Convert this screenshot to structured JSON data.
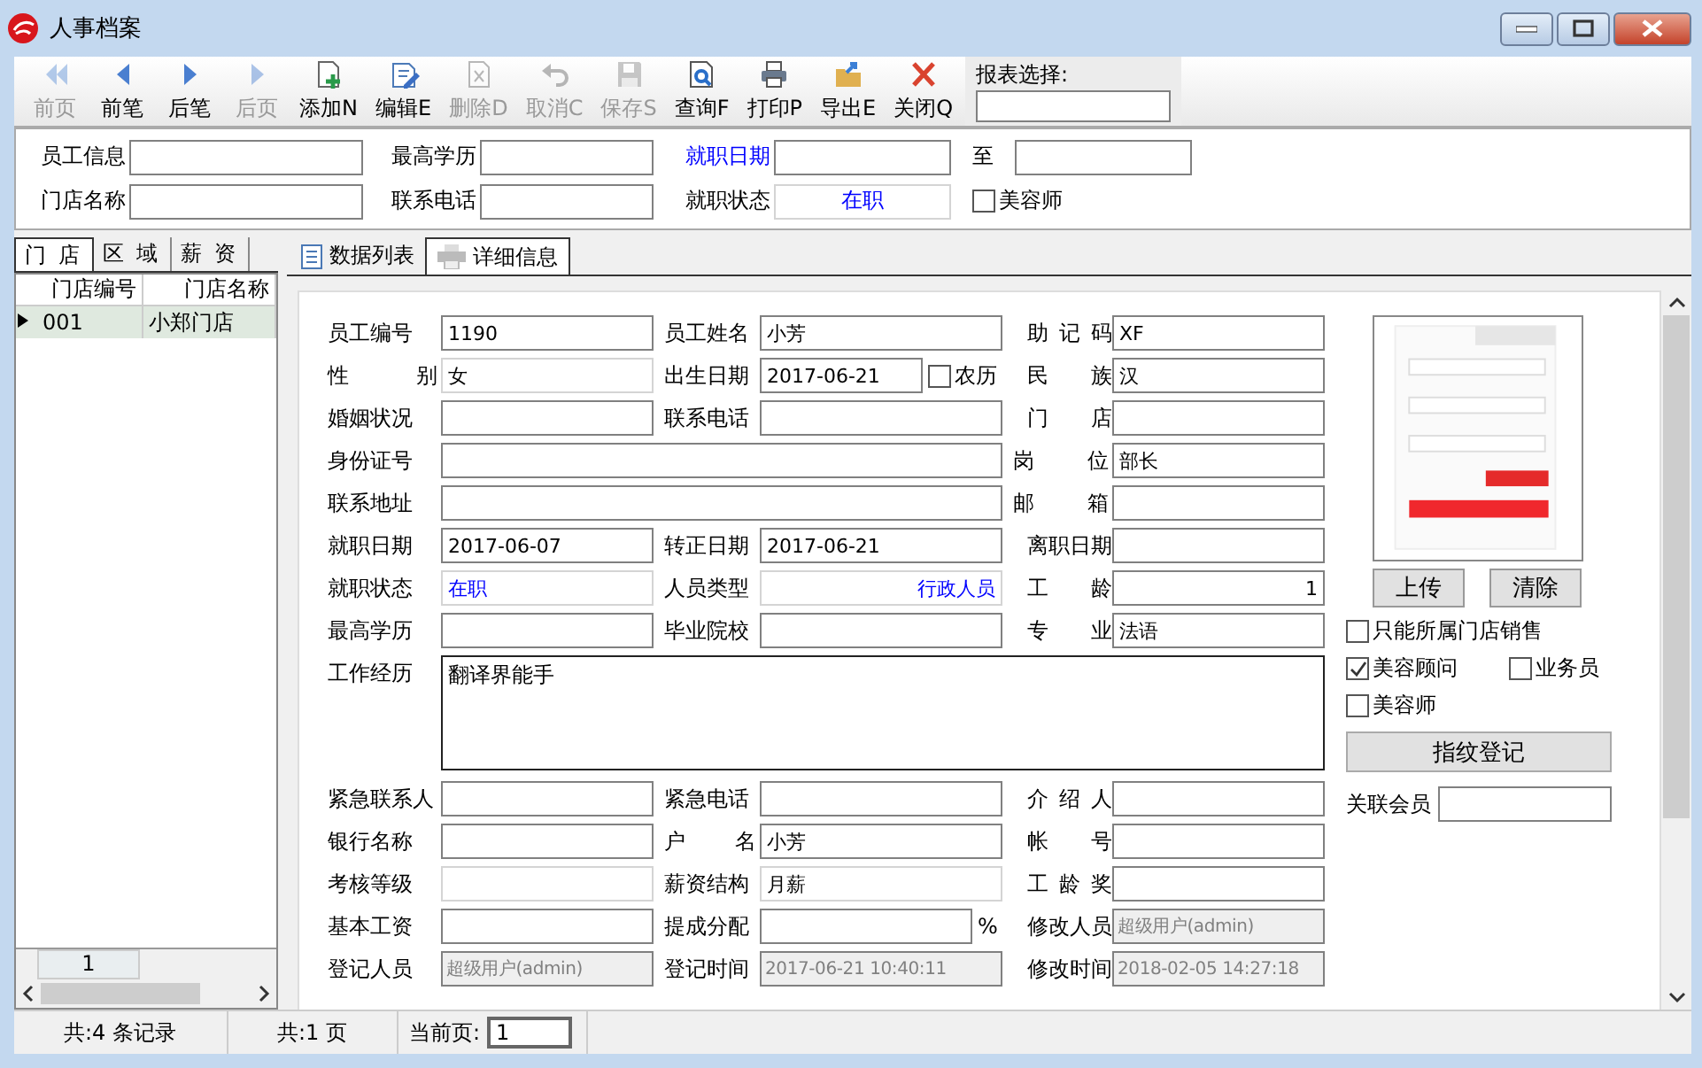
{
  "window": {
    "title": "人事档案"
  },
  "toolbar": {
    "buttons": [
      {
        "label": "前页",
        "kind": "first",
        "disabled": true
      },
      {
        "label": "前笔",
        "kind": "prev",
        "disabled": false
      },
      {
        "label": "后笔",
        "kind": "next",
        "disabled": false
      },
      {
        "label": "后页",
        "kind": "last",
        "disabled": true
      },
      {
        "label": "添加N",
        "kind": "add",
        "disabled": false
      },
      {
        "label": "编辑E",
        "kind": "edit",
        "disabled": false
      },
      {
        "label": "删除D",
        "kind": "delete",
        "disabled": true
      },
      {
        "label": "取消C",
        "kind": "undo",
        "disabled": true
      },
      {
        "label": "保存S",
        "kind": "save",
        "disabled": true
      },
      {
        "label": "查询F",
        "kind": "query",
        "disabled": false
      },
      {
        "label": "打印P",
        "kind": "print",
        "disabled": false
      },
      {
        "label": "导出E",
        "kind": "export",
        "disabled": false
      },
      {
        "label": "关闭Q",
        "kind": "close",
        "disabled": false
      }
    ],
    "report_select": {
      "label": "报表选择:"
    }
  },
  "filter": {
    "fields": [
      {
        "label": "员工信息",
        "kind": "text"
      },
      {
        "label": "最高学历",
        "kind": "text"
      },
      {
        "label": "就职日期",
        "kind": "date_range",
        "separator": "至"
      },
      {
        "label": "门店名称",
        "kind": "text"
      },
      {
        "label": "联系电话",
        "kind": "text"
      },
      {
        "label": "就职状态",
        "kind": "choice",
        "value": "在职"
      },
      {
        "label": "美容师",
        "kind": "checkbox",
        "checked": false
      }
    ]
  },
  "side_panel": {
    "tabs": [
      {
        "label": "门店",
        "selected": true
      },
      {
        "label": "区域",
        "selected": false
      },
      {
        "label": "薪资",
        "selected": false
      }
    ],
    "table": {
      "columns": [
        "门店编号",
        "门店名称"
      ],
      "rows": [
        {
          "cells": [
            "001",
            "小郑门店"
          ],
          "selected": true
        }
      ]
    },
    "pager": {
      "page": "1"
    }
  },
  "detail": {
    "tabs": [
      {
        "label": "数据列表",
        "kind": "list",
        "selected": false
      },
      {
        "label": "详细信息",
        "kind": "print",
        "selected": true
      }
    ],
    "rows": [
      {
        "fields": [
          {
            "label": "员工编号",
            "value": "1190",
            "kind": "text",
            "readonly": false,
            "disabled": false
          },
          {
            "label": "员工姓名",
            "value": "小芳",
            "kind": "text",
            "readonly": false,
            "disabled": false
          },
          {
            "label": "助 记 码",
            "value": "XF",
            "kind": "text",
            "readonly": false,
            "disabled": false
          }
        ]
      },
      {
        "fields": [
          {
            "label": "性 别",
            "value": "女",
            "kind": "text",
            "readonly": true,
            "disabled": false
          },
          {
            "label": "出生日期",
            "value": "2017-06-21",
            "kind": "date_lunar",
            "readonly": false,
            "disabled": false,
            "checkbox": {
              "label": "农历",
              "checked": false
            }
          },
          {
            "label": "民 族",
            "value": "汉",
            "kind": "text",
            "readonly": false,
            "disabled": false
          }
        ]
      },
      {
        "fields": [
          {
            "label": "婚姻状况",
            "kind": "text",
            "readonly": false,
            "disabled": false
          },
          {
            "label": "联系电话",
            "kind": "text",
            "readonly": false,
            "disabled": false
          },
          {
            "label": "门 店",
            "kind": "text",
            "readonly": false,
            "disabled": false
          }
        ]
      },
      {
        "fields": [
          {
            "label": "身份证号",
            "kind": "wide",
            "readonly": false,
            "disabled": false
          },
          {
            "label": "岗 位",
            "value": "部长",
            "kind": "text",
            "readonly": false,
            "disabled": false
          }
        ]
      },
      {
        "fields": [
          {
            "label": "联系地址",
            "kind": "wide",
            "readonly": false,
            "disabled": false
          },
          {
            "label": "邮 箱",
            "kind": "text",
            "readonly": false,
            "disabled": false
          }
        ]
      },
      {
        "fields": [
          {
            "label": "就职日期",
            "value": "2017-06-07",
            "kind": "text",
            "readonly": false,
            "disabled": false
          },
          {
            "label": "转正日期",
            "value": "2017-06-21",
            "kind": "text",
            "readonly": false,
            "disabled": false
          },
          {
            "label": "离职日期",
            "kind": "text",
            "readonly": false,
            "disabled": false
          }
        ]
      },
      {
        "fields": [
          {
            "label": "就职状态",
            "value": "在职",
            "kind": "choice",
            "readonly": true,
            "disabled": false
          },
          {
            "label": "人员类型",
            "value": "行政人员",
            "kind": "choice_right",
            "readonly": true,
            "disabled": false
          },
          {
            "label": "工 龄",
            "value": "1",
            "kind": "number",
            "readonly": false,
            "disabled": false
          }
        ]
      },
      {
        "fields": [
          {
            "label": "最高学历",
            "kind": "text",
            "readonly": false,
            "disabled": false
          },
          {
            "label": "毕业院校",
            "kind": "text",
            "readonly": false,
            "disabled": false
          },
          {
            "label": "专 业",
            "value": "法语",
            "kind": "text",
            "readonly": false,
            "disabled": false
          }
        ]
      },
      {
        "fields": [
          {
            "label": "工作经历",
            "value": "翻译界能手",
            "kind": "textarea",
            "readonly": false,
            "disabled": false
          }
        ]
      },
      {
        "fields": [
          {
            "label": "紧急联系人",
            "kind": "text",
            "readonly": false,
            "disabled": false
          },
          {
            "label": "紧急电话",
            "kind": "text",
            "readonly": false,
            "disabled": false
          },
          {
            "label": "介 绍 人",
            "kind": "text",
            "readonly": false,
            "disabled": false
          }
        ]
      },
      {
        "fields": [
          {
            "label": "银行名称",
            "kind": "text",
            "readonly": false,
            "disabled": false
          },
          {
            "label": "户 名",
            "value": "小芳",
            "kind": "text",
            "readonly": false,
            "disabled": false
          },
          {
            "label": "帐 号",
            "kind": "text",
            "readonly": false,
            "disabled": false
          }
        ]
      },
      {
        "fields": [
          {
            "label": "考核等级",
            "kind": "text",
            "readonly": true,
            "disabled": false
          },
          {
            "label": "薪资结构",
            "value": "月薪",
            "kind": "text",
            "readonly": true,
            "disabled": false
          },
          {
            "label": "工 龄 奖",
            "kind": "text",
            "readonly": false,
            "disabled": false
          }
        ]
      },
      {
        "fields": [
          {
            "label": "基本工资",
            "kind": "text",
            "readonly": false,
            "disabled": false
          },
          {
            "label": "提成分配",
            "kind": "percent",
            "suffix": "%",
            "readonly": false,
            "disabled": false
          },
          {
            "label": "修改人员",
            "value": "超级用户(admin)",
            "kind": "text",
            "readonly": false,
            "disabled": true
          }
        ]
      },
      {
        "fields": [
          {
            "label": "登记人员",
            "value": "超级用户(admin)",
            "kind": "text",
            "readonly": false,
            "disabled": true
          },
          {
            "label": "登记时间",
            "value": "2017-06-21 10:40:11",
            "kind": "text",
            "readonly": false,
            "disabled": true
          },
          {
            "label": "修改时间",
            "value": "2018-02-05 14:27:18",
            "kind": "text",
            "readonly": false,
            "disabled": true
          }
        ]
      }
    ],
    "photo_buttons": [
      "上传",
      "清除"
    ],
    "options": [
      {
        "label": "只能所属门店销售",
        "checked": false
      },
      {
        "label": "美容顾问",
        "checked": true
      },
      {
        "label": "业务员",
        "checked": false
      },
      {
        "label": "美容师",
        "checked": false
      }
    ],
    "fingerprint_button": "指纹登记",
    "member": {
      "label": "关联会员"
    }
  },
  "status_bar": {
    "records": "共:4 条记录",
    "pages": "共:1 页",
    "current_page": {
      "label": "当前页:",
      "value": "1"
    }
  }
}
